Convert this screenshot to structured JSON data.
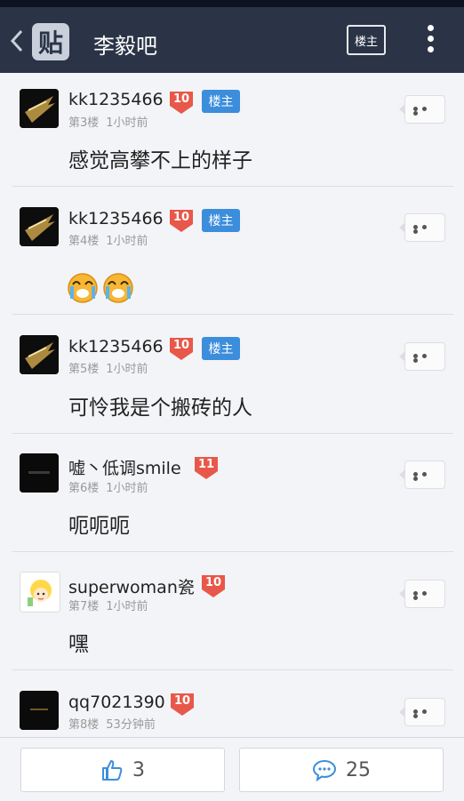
{
  "header": {
    "logo_text": "贴",
    "title": "李毅吧",
    "op_only_label": "楼主",
    "icons": [
      "back-chevron-icon",
      "more-vertical-icon"
    ]
  },
  "posts": [
    {
      "username": "kk1235466",
      "level": "10",
      "op_badge": "楼主",
      "floor": "第3楼",
      "time": "1小时前",
      "content": "感觉高攀不上的样子",
      "avatar": "dark-gold-avatar"
    },
    {
      "username": "kk1235466",
      "level": "10",
      "op_badge": "楼主",
      "floor": "第4楼",
      "time": "1小时前",
      "content": "",
      "emojis": [
        "crying-face-emoji",
        "crying-face-emoji"
      ],
      "avatar": "dark-gold-avatar"
    },
    {
      "username": "kk1235466",
      "level": "10",
      "op_badge": "楼主",
      "floor": "第5楼",
      "time": "1小时前",
      "content": "可怜我是个搬砖的人",
      "avatar": "dark-gold-avatar"
    },
    {
      "username": "嘘丶低调smile",
      "level": "11",
      "floor": "第6楼",
      "time": "1小时前",
      "content": "呃呃呃",
      "avatar": "black-avatar"
    },
    {
      "username": "superwoman瓷",
      "level": "10",
      "floor": "第7楼",
      "time": "1小时前",
      "content": "嘿",
      "avatar": "cartoon-girl-avatar"
    },
    {
      "username": "qq7021390",
      "level": "10",
      "floor": "第8楼",
      "time": "53分钟前",
      "content": "",
      "avatar": "black-text-avatar"
    }
  ],
  "bottom_bar": {
    "like_count": "3",
    "reply_count": "25",
    "icons": [
      "thumbs-up-icon",
      "comment-bubble-icon"
    ]
  },
  "colors": {
    "titlebar": "#2a3446",
    "level_badge": "#e8584a",
    "op_badge": "#3c8edc",
    "background": "#f3f4f7"
  }
}
